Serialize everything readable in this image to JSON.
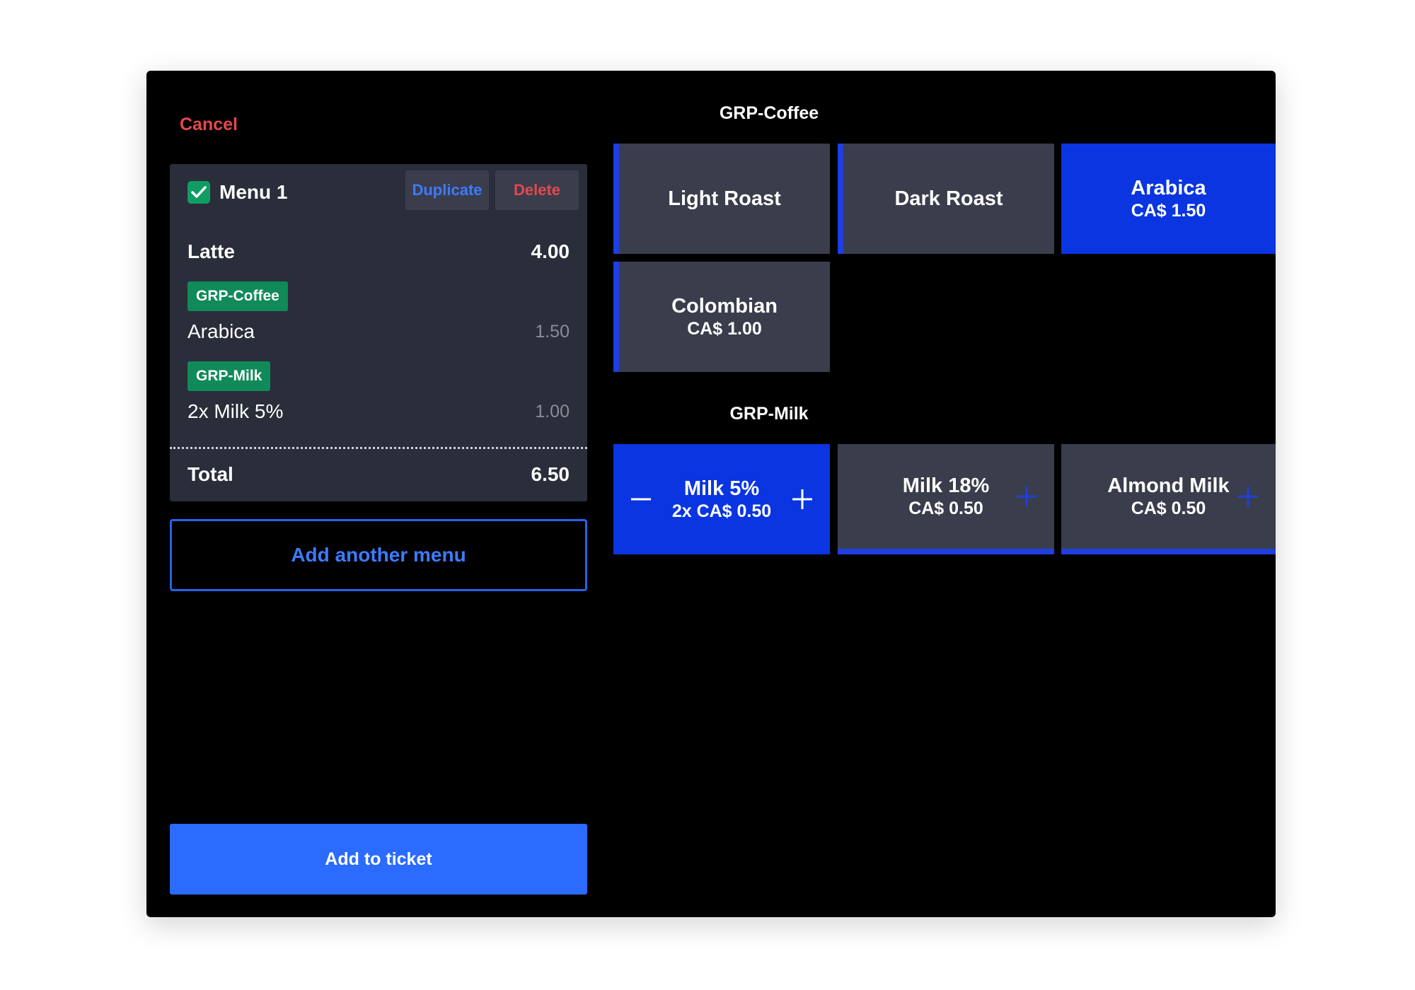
{
  "header": {
    "cancel_label": "Cancel"
  },
  "menu": {
    "name": "Menu 1",
    "checked": true,
    "duplicate_label": "Duplicate",
    "delete_label": "Delete",
    "main_item": {
      "name": "Latte",
      "price": "4.00"
    },
    "modifiers": [
      {
        "group": "GRP-Coffee",
        "name": "Arabica",
        "price": "1.50"
      },
      {
        "group": "GRP-Milk",
        "name": "2x Milk 5%",
        "price": "1.00"
      }
    ],
    "total_label": "Total",
    "total_value": "6.50"
  },
  "actions": {
    "add_another_menu": "Add another menu",
    "add_to_ticket": "Add to ticket"
  },
  "groups": [
    {
      "title": "GRP-Coffee",
      "options": [
        {
          "name": "Light Roast",
          "price": "",
          "selected": false
        },
        {
          "name": "Dark Roast",
          "price": "",
          "selected": false
        },
        {
          "name": "Arabica",
          "price": "CA$ 1.50",
          "selected": true
        },
        {
          "name": "Colombian",
          "price": "CA$ 1.00",
          "selected": false
        }
      ]
    },
    {
      "title": "GRP-Milk",
      "options": [
        {
          "name": "Milk 5%",
          "price": "2x CA$ 0.50",
          "selected": true,
          "quantity": 2
        },
        {
          "name": "Milk 18%",
          "price": "CA$ 0.50",
          "selected": false,
          "quantity": 0
        },
        {
          "name": "Almond Milk",
          "price": "CA$ 0.50",
          "selected": false,
          "quantity": 0
        }
      ]
    }
  ],
  "colors": {
    "accent_blue": "#2b6bff",
    "selected_tile": "#0a35e0",
    "tag_green": "#0f8a58",
    "cancel_red": "#e5484d"
  }
}
